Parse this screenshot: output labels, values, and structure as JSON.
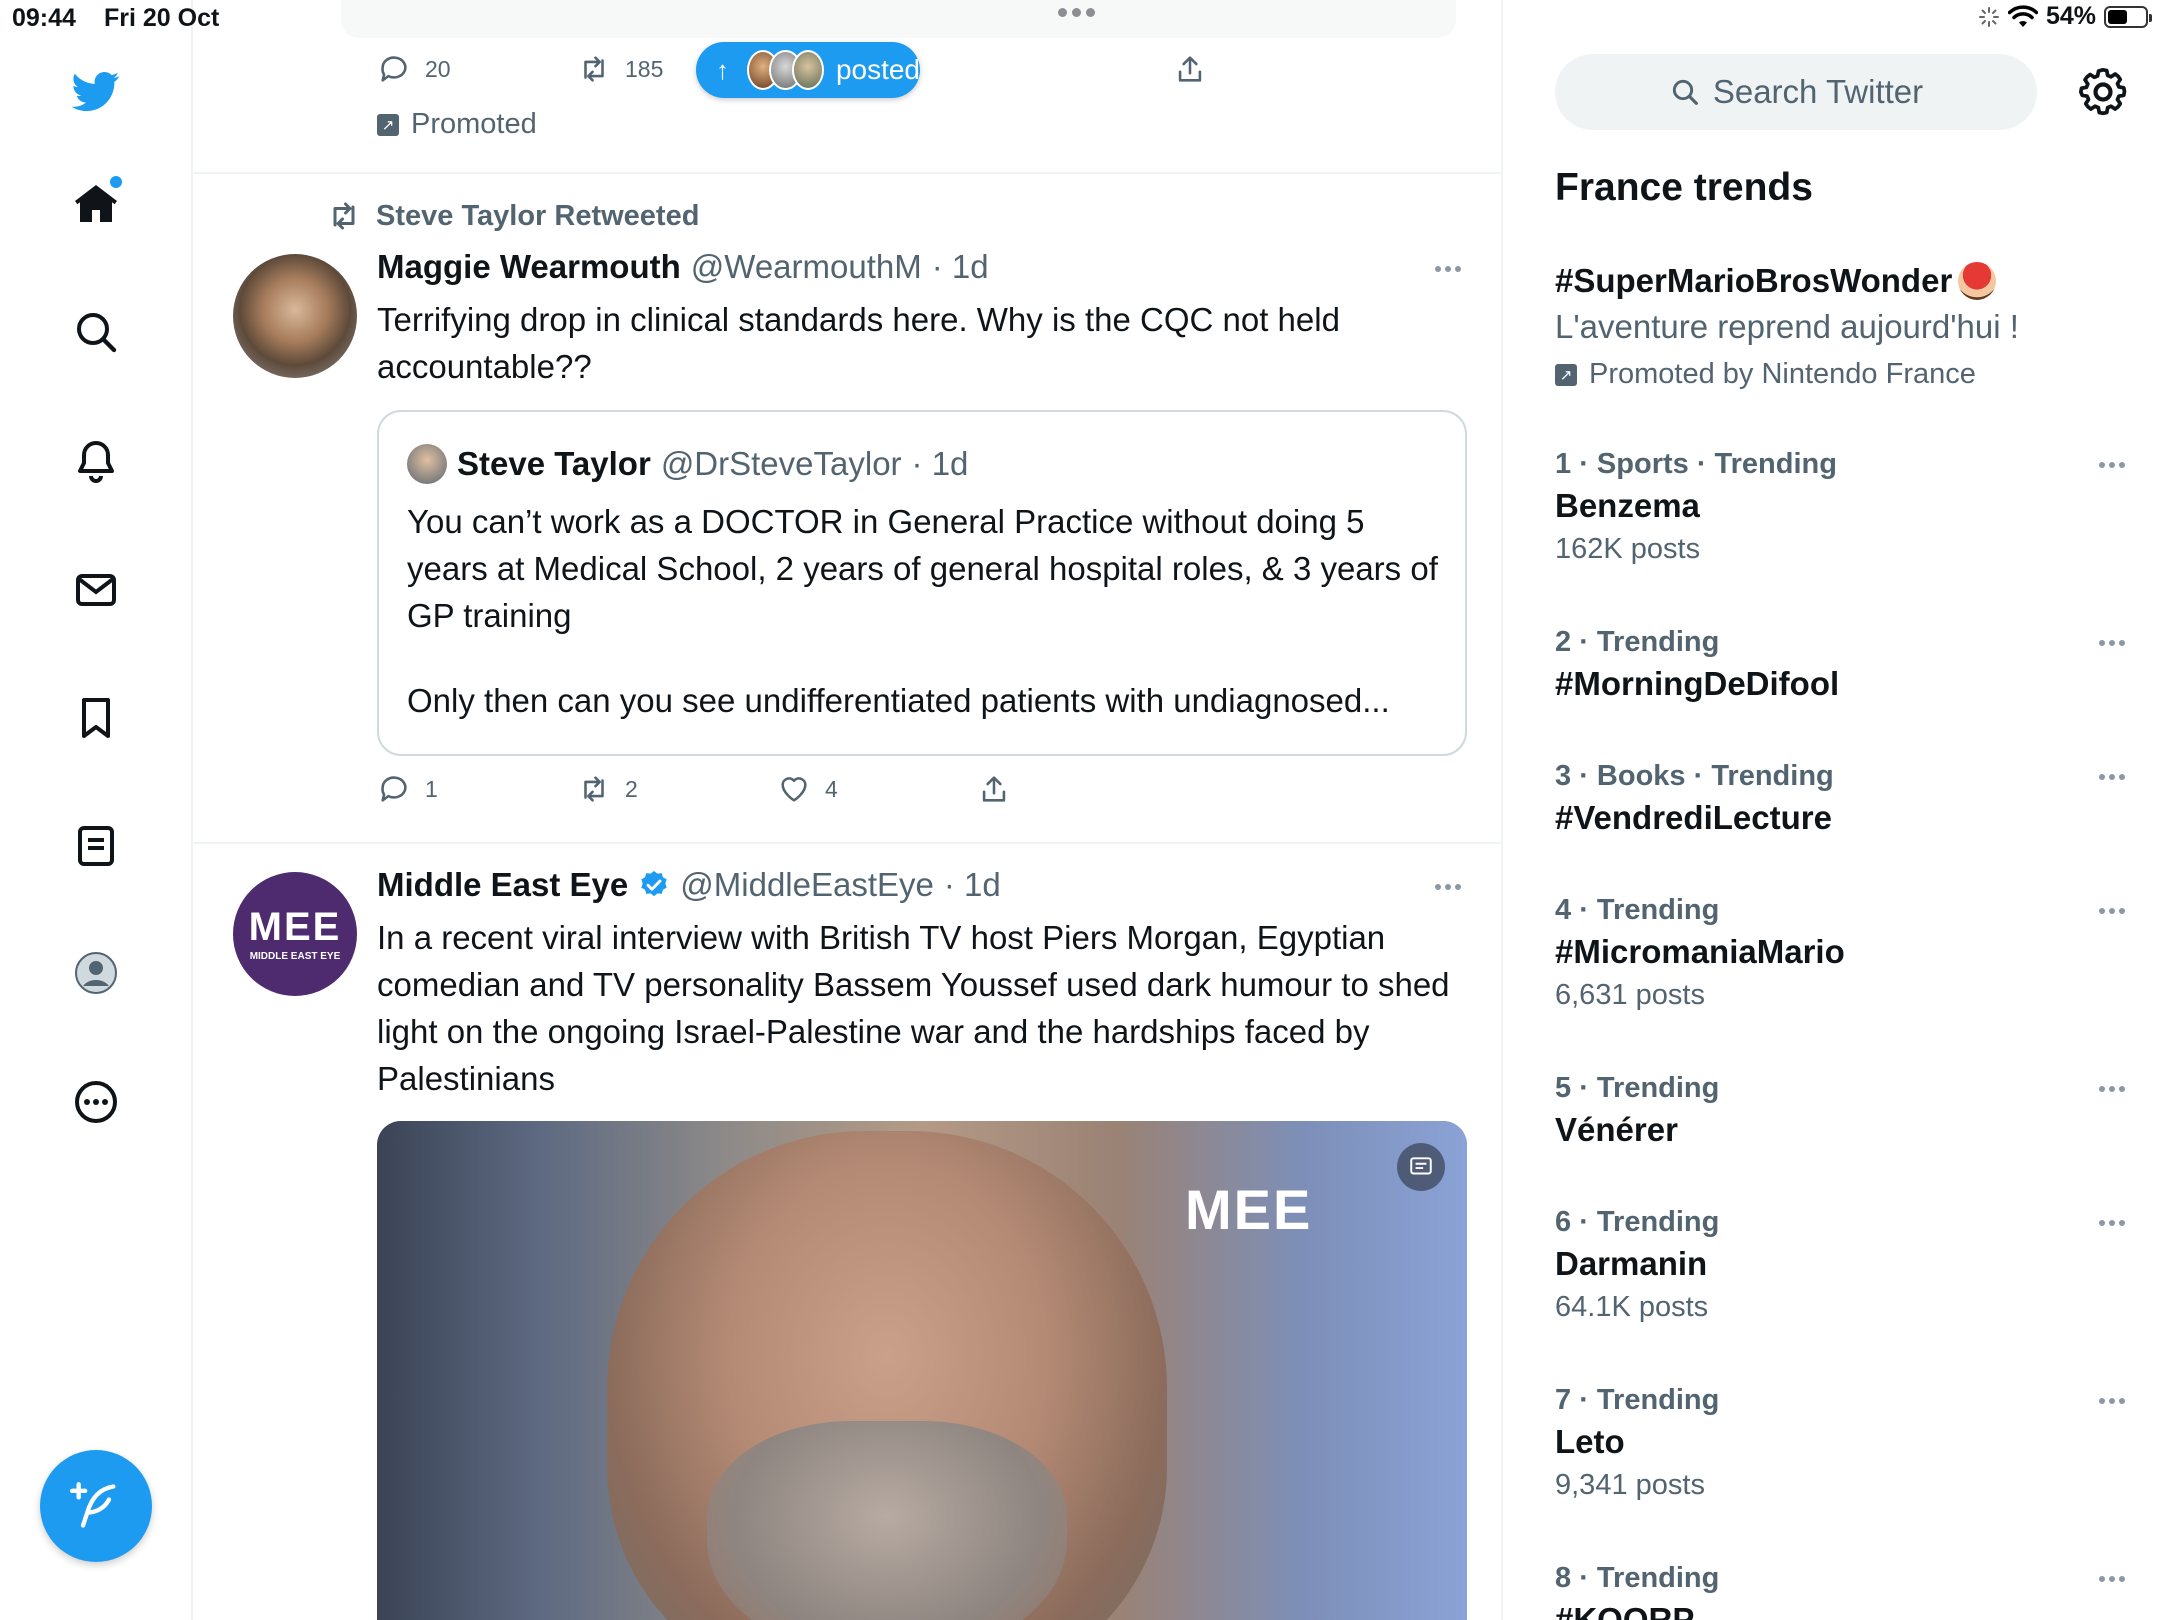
{
  "status_bar": {
    "time": "09:44",
    "date": "Fri 20 Oct",
    "battery": "54%"
  },
  "colors": {
    "accent": "#1d9bf0",
    "text": "#0f1419",
    "muted": "#536471",
    "border": "#eff3f4"
  },
  "sidebar": {
    "items": [
      {
        "name": "twitter-logo-icon"
      },
      {
        "name": "home-icon"
      },
      {
        "name": "search-icon"
      },
      {
        "name": "notifications-bell-icon"
      },
      {
        "name": "messages-envelope-icon"
      },
      {
        "name": "bookmarks-icon"
      },
      {
        "name": "lists-icon"
      },
      {
        "name": "profile-icon"
      },
      {
        "name": "more-circle-icon"
      }
    ],
    "compose_icon": "compose-feather-icon"
  },
  "timeline": {
    "prev_tweet": {
      "replies": "20",
      "retweets": "185",
      "promoted_label": "Promoted"
    },
    "new_posts_pill": {
      "label": "posted"
    },
    "tweet1": {
      "retweeted_by": "Steve Taylor Retweeted",
      "name": "Maggie Wearmouth",
      "handle": "@WearmouthM",
      "time": "· 1d",
      "text": "Terrifying drop in clinical standards here. Why is the CQC not held accountable??",
      "quote": {
        "name": "Steve Taylor",
        "handle": "@DrSteveTaylor",
        "time": "· 1d",
        "text1": "You can’t work as a DOCTOR in General Practice without doing 5 years at Medical School, 2 years of general hospital roles, & 3 years of GP training",
        "text2": "Only then can you see undifferentiated patients with undiagnosed..."
      },
      "replies": "1",
      "retweets": "2",
      "likes": "4"
    },
    "tweet2": {
      "name": "Middle East Eye",
      "handle": "@MiddleEastEye",
      "time": "· 1d",
      "text": "In a recent viral interview with British TV host Piers Morgan, Egyptian comedian and TV personality Bassem Youssef used dark humour to shed light on the ongoing Israel-Palestine war and the hardships faced by Palestinians",
      "avatar_text": "MEE",
      "avatar_sub": "MIDDLE EAST EYE",
      "media_watermark": "MEE"
    }
  },
  "right": {
    "search_placeholder": "Search Twitter",
    "trends_title": "France trends",
    "promoted_trend": {
      "title": "#SuperMarioBrosWonder",
      "desc": "L'aventure reprend aujourd'hui !",
      "by": "Promoted by Nintendo France"
    },
    "trends": [
      {
        "rank": "1",
        "category": "· Sports · Trending",
        "title": "Benzema",
        "count": "162K posts"
      },
      {
        "rank": "2",
        "category": "· Trending",
        "title": "#MorningDeDifool",
        "count": ""
      },
      {
        "rank": "3",
        "category": "· Books · Trending",
        "title": "#VendrediLecture",
        "count": ""
      },
      {
        "rank": "4",
        "category": "· Trending",
        "title": "#MicromaniaMario",
        "count": "6,631 posts"
      },
      {
        "rank": "5",
        "category": "· Trending",
        "title": "Vénérer",
        "count": ""
      },
      {
        "rank": "6",
        "category": "· Trending",
        "title": "Darmanin",
        "count": "64.1K posts"
      },
      {
        "rank": "7",
        "category": "· Trending",
        "title": "Leto",
        "count": "9,341 posts"
      },
      {
        "rank": "8",
        "category": "· Trending",
        "title": "#KOORP",
        "count": ""
      }
    ]
  }
}
